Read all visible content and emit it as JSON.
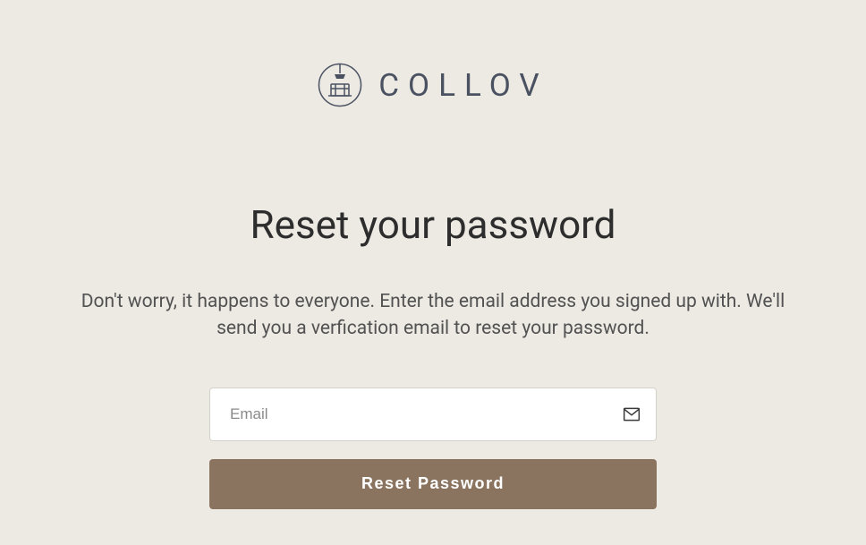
{
  "logo": {
    "brand_name": "COLLOV",
    "icon_color": "#4a5262"
  },
  "heading": "Reset your password",
  "description": "Don't worry, it happens to everyone. Enter the email address you signed up with. We'll send you a verfication email to reset your password.",
  "form": {
    "email_placeholder": "Email",
    "email_value": "",
    "button_label": "Reset Password"
  }
}
